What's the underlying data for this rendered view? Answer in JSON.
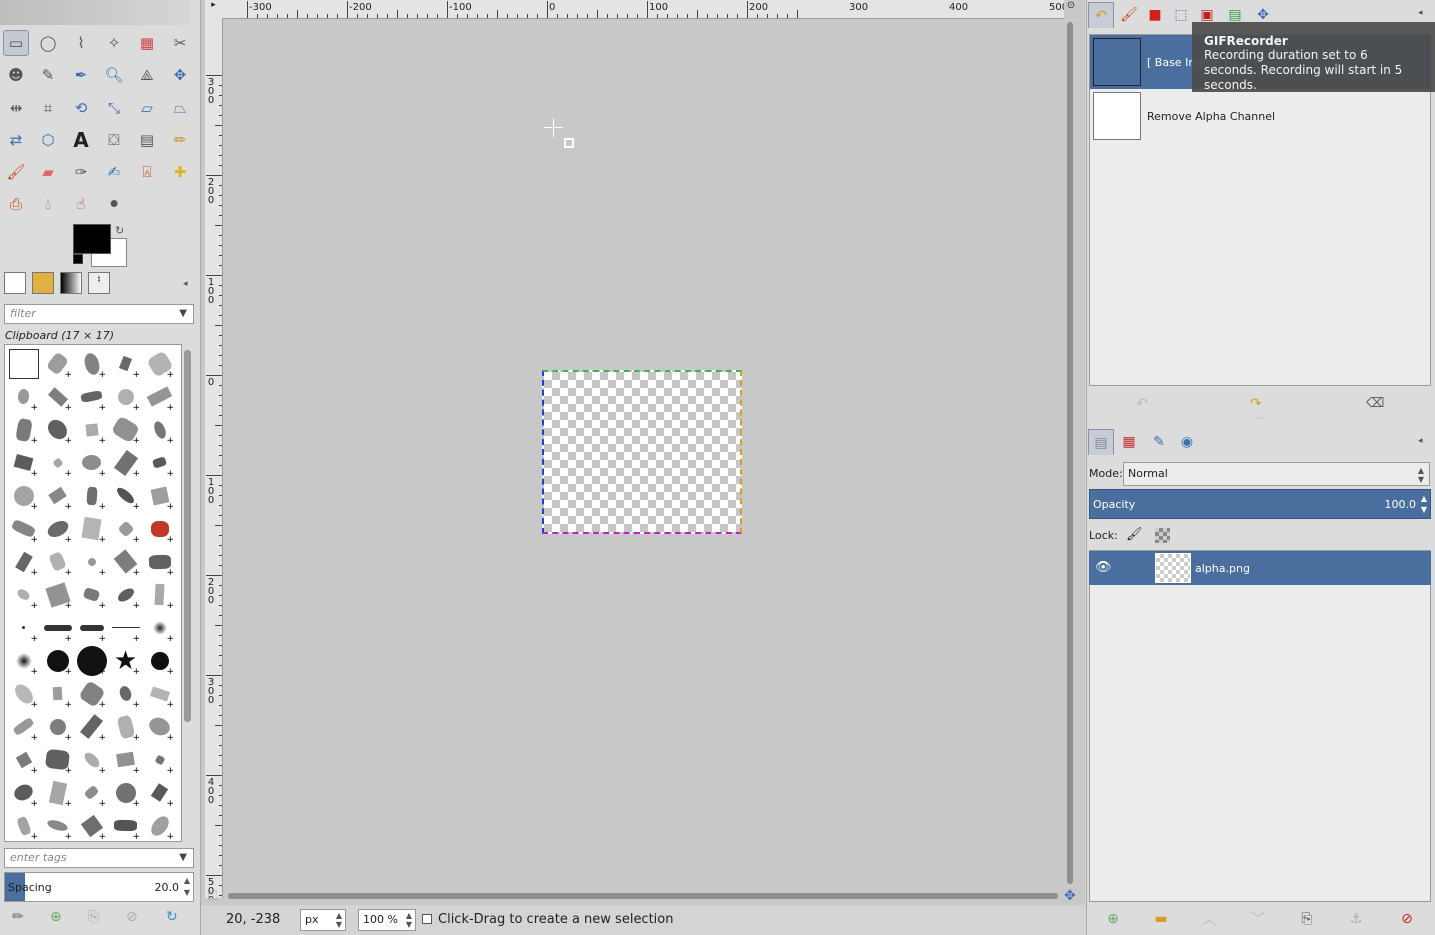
{
  "toolbox": {
    "filter_placeholder": "filter",
    "brush_title": "Clipboard (17 × 17)",
    "tags_placeholder": "enter tags",
    "spacing_label": "Spacing",
    "spacing_value": "20.0"
  },
  "rulers": {
    "h_labels": [
      "-300",
      "-200",
      "-100",
      "0",
      "100",
      "200",
      "300",
      "400",
      "500"
    ],
    "v_labels": [
      "300",
      "200",
      "100",
      "0",
      "100",
      "200",
      "300",
      "400",
      "500"
    ]
  },
  "status": {
    "coords": "20, -238",
    "unit": "px",
    "zoom": "100 %",
    "message": "Click-Drag to create a new selection"
  },
  "undo_history": {
    "items": [
      {
        "label": "[ Base Image ]"
      },
      {
        "label": "Remove Alpha Channel"
      }
    ]
  },
  "tooltip": {
    "title": "GIFRecorder",
    "body": "Recording duration set to 6 seconds. Recording will start in 5 seconds."
  },
  "layers": {
    "mode_label": "Mode:",
    "mode_value": "Normal",
    "opacity_label": "Opacity",
    "opacity_value": "100.0",
    "lock_label": "Lock:",
    "items": [
      {
        "name": "alpha.png"
      }
    ]
  },
  "colors": {
    "selection_blue": "#4a6f9e",
    "canvas_bg": "#c8c8c8",
    "fg_color": "#000000",
    "bg_color": "#ffffff"
  }
}
